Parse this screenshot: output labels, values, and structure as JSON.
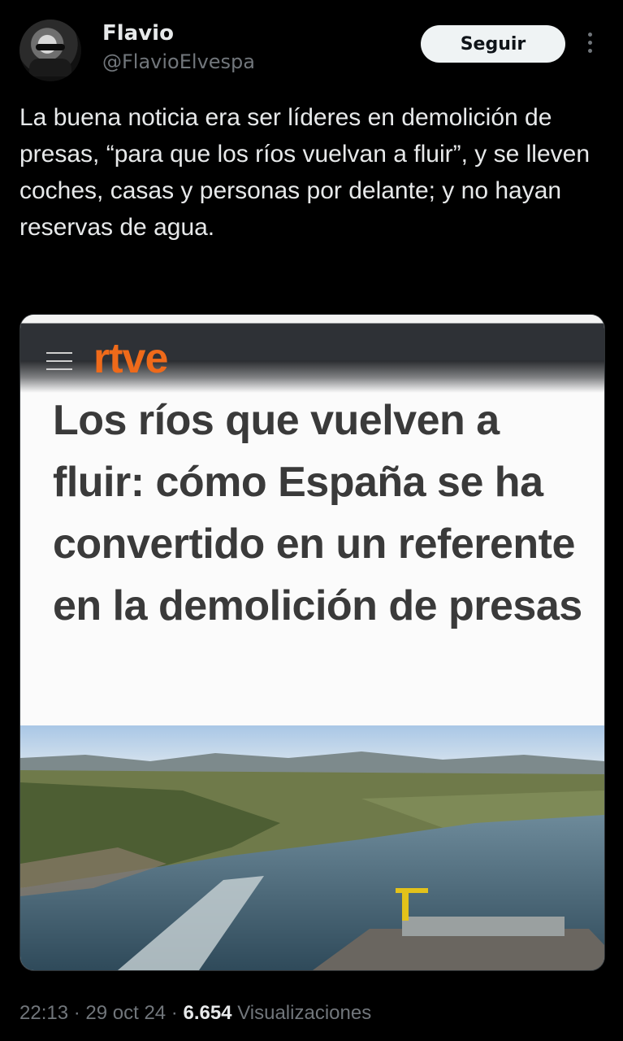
{
  "author": {
    "name": "Flavio",
    "handle": "@FlavioElvespa"
  },
  "actions": {
    "follow_label": "Seguir"
  },
  "tweet": {
    "text": "La buena noticia era ser líderes en demolición de presas, “para que los ríos vuelvan a fluir”, y se lleven coches, casas y personas por delante; y no hayan reservas de agua."
  },
  "media": {
    "logo_text": "rtve",
    "headline": "Los ríos que vuelven a fluir: cómo España se ha convertido en un referente en la demolición de presas"
  },
  "meta": {
    "time": "22:13",
    "separator": " · ",
    "date": "29 oct 24",
    "views_count": "6.654",
    "views_label": "Visualizaciones"
  },
  "colors": {
    "background": "#000000",
    "text": "#e7e9ea",
    "muted": "#71767b",
    "rtve_orange": "#ef6a1a",
    "follow_bg": "#eff3f4"
  },
  "icons": {
    "more": "more-vertical-icon",
    "menu": "hamburger-menu-icon"
  }
}
